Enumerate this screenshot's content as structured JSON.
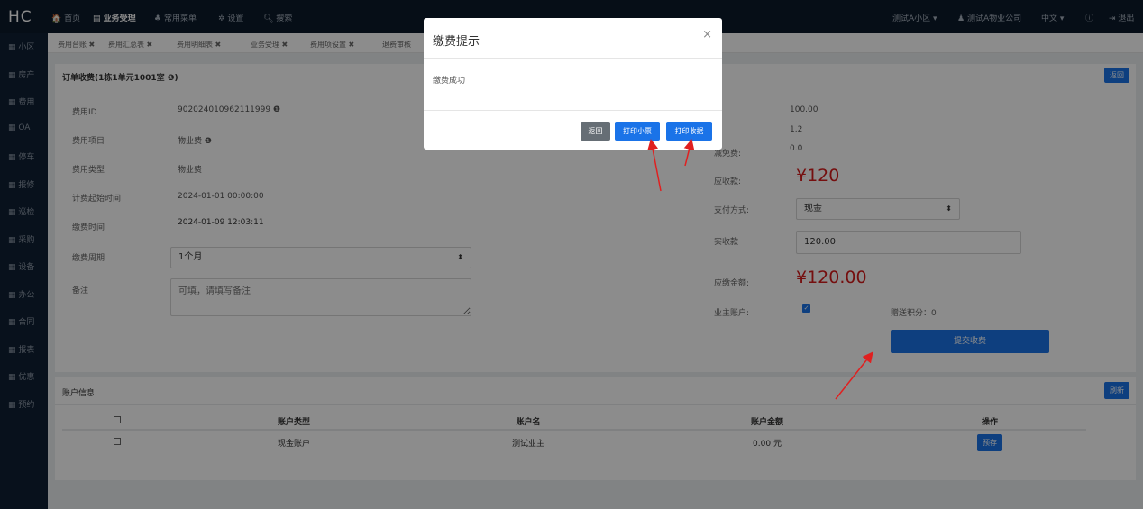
{
  "topbar": {
    "logo": "HC",
    "nav": [
      "首页",
      "业务受理",
      "常用菜单",
      "设置",
      "搜索"
    ],
    "right": [
      "测试A小区",
      "测试A物业公司",
      "中文",
      "退出"
    ]
  },
  "sidebar": [
    "小区",
    "房产",
    "费用",
    "OA",
    "停车",
    "报修",
    "巡检",
    "采购",
    "设备",
    "办公",
    "合同",
    "报表",
    "优惠",
    "预约"
  ],
  "tabs": [
    "费用台账",
    "费用汇总表",
    "费用明细表",
    "业务受理",
    "费用项设置",
    "退费审核"
  ],
  "order": {
    "title": "订单收费(1栋1单元1001室",
    "back": "返回",
    "fee_id_label": "费用ID",
    "fee_id": "902024010962111999",
    "fee_item_label": "费用项目",
    "fee_item": "物业费",
    "fee_type_label": "费用类型",
    "fee_type": "物业费",
    "start_label": "计费起始时间",
    "start": "2024-01-01 00:00:00",
    "pay_time_label": "缴费时间",
    "pay_time": "2024-01-09 12:03:11",
    "cycle_label": "缴费周期",
    "cycle": "1个月",
    "remark_label": "备注",
    "remark_placeholder": "可填，请填写备注"
  },
  "right": {
    "v1": "100.00",
    "v2": "1.2",
    "disc_label": "减免费:",
    "v3": "0.0",
    "due_label": "应收款:",
    "due": "¥120",
    "pay_method_label": "支付方式:",
    "pay_method": "现金",
    "received_label": "实收款",
    "received": "120.00",
    "amount_label": "应缴金额:",
    "amount": "¥120.00",
    "owner_label": "业主账户:",
    "points": "赠送积分：0",
    "submit": "提交收费"
  },
  "account": {
    "title": "账户信息",
    "refresh": "刷新",
    "headers": [
      "账户类型",
      "账户名",
      "账户金额",
      "操作"
    ],
    "rows": [
      {
        "type": "现金账户",
        "name": "测试业主",
        "amount": "0.00 元",
        "action": "预存"
      }
    ]
  },
  "modal": {
    "title": "缴费提示",
    "message": "缴费成功",
    "back": "返回",
    "print_ticket": "打印小票",
    "print_receipt": "打印收据"
  },
  "colors": {
    "brand": "#1a73e8",
    "price": "#d61c1c",
    "nav_bg": "#0c1a2b"
  }
}
